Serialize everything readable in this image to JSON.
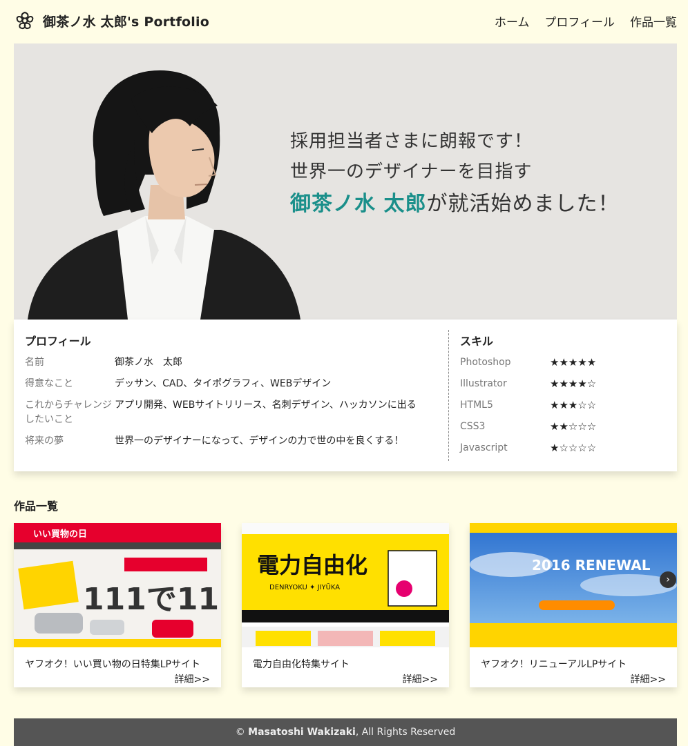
{
  "header": {
    "site_title": "御茶ノ水 太郎's Portfolio",
    "nav": [
      "ホーム",
      "プロフィール",
      "作品一覧"
    ]
  },
  "hero": {
    "line1": "採用担当者さまに朗報です！",
    "line2": "世界一のデザイナーを目指す",
    "name": "御茶ノ水 太郎",
    "line3_suffix": "が就活始めました！",
    "accent_color": "#1a8f8a"
  },
  "profile": {
    "heading": "プロフィール",
    "rows": [
      {
        "label": "名前",
        "value": "御茶ノ水　太郎"
      },
      {
        "label": "得意なこと",
        "value": "デッサン、CAD、タイポグラフィ、WEBデザイン"
      },
      {
        "label": "これからチャレンジしたいこと",
        "value": "アプリ開発、WEBサイトリリース、名刺デザイン、ハッカソンに出る"
      },
      {
        "label": "将来の夢",
        "value": "世界一のデザイナーになって、デザインの力で世の中を良くする！"
      }
    ]
  },
  "skills": {
    "heading": "スキル",
    "rows": [
      {
        "name": "Photoshop",
        "stars": "★★★★★",
        "rating": 5
      },
      {
        "name": "Illustrator",
        "stars": "★★★★☆",
        "rating": 4
      },
      {
        "name": "HTML5",
        "stars": "★★★☆☆",
        "rating": 3
      },
      {
        "name": "CSS3",
        "stars": "★★☆☆☆",
        "rating": 2
      },
      {
        "name": "Javascript",
        "stars": "★☆☆☆☆",
        "rating": 1
      }
    ]
  },
  "works": {
    "heading": "作品一覧",
    "more_label": "詳細>>",
    "items": [
      {
        "title": "ヤフオク！いい買い物の日特集LPサイト",
        "thumb_text": "111で11",
        "thumb_banner": "いい買物の日"
      },
      {
        "title": "電力自由化特集サイト",
        "thumb_text": "電力自由化",
        "thumb_sub": "DENRYOKU ✦ JIYŪKA"
      },
      {
        "title": "ヤフオク！リニューアルLPサイト",
        "thumb_text": "2016 RENEWAL"
      }
    ]
  },
  "footer": {
    "copyright_prefix": "© ",
    "author": "Masatoshi Wakizaki",
    "rights": ", All Rights Reserved"
  }
}
